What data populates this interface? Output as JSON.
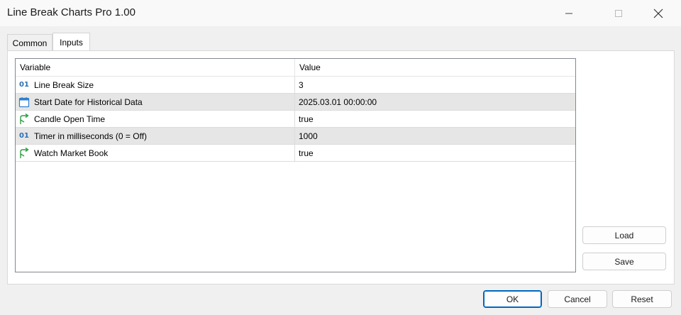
{
  "window": {
    "title": "Line Break Charts Pro 1.00"
  },
  "tabs": [
    {
      "label": "Common",
      "active": false
    },
    {
      "label": "Inputs",
      "active": true
    }
  ],
  "grid": {
    "columns": {
      "variable": "Variable",
      "value": "Value"
    },
    "rows": [
      {
        "icon": "numeric-icon",
        "icon_text": "01",
        "variable": "Line Break Size",
        "value": "3"
      },
      {
        "icon": "calendar-icon",
        "variable": "Start Date for Historical Data",
        "value": "2025.03.01 00:00:00"
      },
      {
        "icon": "boolean-arrow-icon",
        "variable": "Candle Open Time",
        "value": "true"
      },
      {
        "icon": "numeric-icon",
        "icon_text": "01",
        "variable": "Timer in milliseconds (0 = Off)",
        "value": "1000"
      },
      {
        "icon": "boolean-arrow-icon",
        "variable": "Watch Market Book",
        "value": "true"
      }
    ]
  },
  "side_buttons": {
    "load": "Load",
    "save": "Save"
  },
  "footer_buttons": {
    "ok": "OK",
    "cancel": "Cancel",
    "reset": "Reset"
  },
  "colors": {
    "accent": "#0067c0",
    "numeric_icon": "#2d6fb3",
    "calendar_icon": "#2d7fd0",
    "boolean_icon": "#2e9e3e",
    "alt_row": "#e6e6e6"
  }
}
